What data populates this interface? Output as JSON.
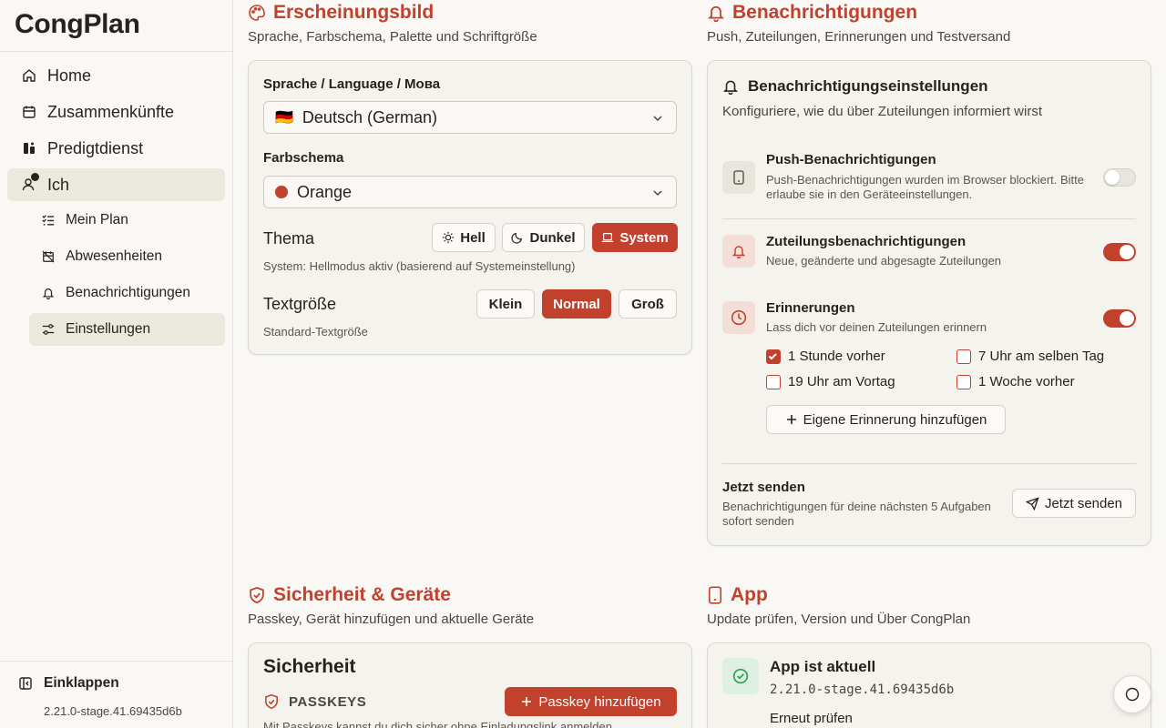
{
  "app": {
    "name": "CongPlan"
  },
  "sidebar": {
    "items": [
      {
        "label": "Home",
        "icon": "home-icon"
      },
      {
        "label": "Zusammenkünfte",
        "icon": "calendar-icon"
      },
      {
        "label": "Predigtdienst",
        "icon": "ministry-icon"
      },
      {
        "label": "Ich",
        "icon": "user-icon",
        "active": true
      }
    ],
    "sub_items": [
      {
        "label": "Mein Plan",
        "icon": "list-check-icon"
      },
      {
        "label": "Abwesenheiten",
        "icon": "calendar-off-icon"
      },
      {
        "label": "Benachrichtigungen",
        "icon": "bell-icon"
      },
      {
        "label": "Einstellungen",
        "icon": "settings-sliders-icon",
        "active": true
      }
    ],
    "collapse_label": "Einklappen",
    "version": "2.21.0-stage.41.69435d6b"
  },
  "appearance": {
    "title": "Erscheinungsbild",
    "subtitle": "Sprache, Farbschema, Palette und Schriftgröße",
    "language_label": "Sprache / Language / Мова",
    "language_flag": "🇩🇪",
    "language_value": "Deutsch (German)",
    "color_scheme_label": "Farbschema",
    "color_scheme_value": "Orange",
    "color_scheme_swatch": "#c2412d",
    "theme_label": "Thema",
    "theme_options": [
      "Hell",
      "Dunkel",
      "System"
    ],
    "theme_selected": "System",
    "theme_hint": "System: Hellmodus aktiv (basierend auf Systemeinstellung)",
    "text_size_label": "Textgröße",
    "text_size_options": [
      "Klein",
      "Normal",
      "Groß"
    ],
    "text_size_selected": "Normal",
    "text_size_hint": "Standard-Textgröße"
  },
  "notifications": {
    "title": "Benachrichtigungen",
    "subtitle": "Push, Zuteilungen, Erinnerungen und Testversand",
    "card_title": "Benachrichtigungseinstellungen",
    "card_subtitle": "Konfiguriere, wie du über Zuteilungen informiert wirst",
    "push_title": "Push-Benachrichtigungen",
    "push_desc": "Push-Benachrichtigungen wurden im Browser blockiert. Bitte erlaube sie in den Geräteeinstellungen.",
    "push_enabled": false,
    "assign_title": "Zuteilungsbenachrichtigungen",
    "assign_desc": "Neue, geänderte und abgesagte Zuteilungen",
    "assign_enabled": true,
    "remind_title": "Erinnerungen",
    "remind_desc": "Lass dich vor deinen Zuteilungen erinnern",
    "remind_enabled": true,
    "reminder_options": [
      {
        "label": "1 Stunde vorher",
        "checked": true
      },
      {
        "label": "7 Uhr am selben Tag",
        "checked": false
      },
      {
        "label": "19 Uhr am Vortag",
        "checked": false
      },
      {
        "label": "1 Woche vorher",
        "checked": false
      }
    ],
    "add_reminder_label": "Eigene Erinnerung hinzufügen",
    "send_title": "Jetzt senden",
    "send_desc": "Benachrichtigungen für deine nächsten 5 Aufgaben sofort senden",
    "send_button": "Jetzt senden"
  },
  "security": {
    "title": "Sicherheit & Geräte",
    "subtitle": "Passkey, Gerät hinzufügen und aktuelle Geräte",
    "card_title": "Sicherheit",
    "passkeys_label": "PASSKEYS",
    "add_passkey_label": "Passkey hinzufügen",
    "passkeys_desc": "Mit Passkeys kannst du dich sicher ohne Einladungslink anmelden"
  },
  "app_section": {
    "title": "App",
    "subtitle": "Update prüfen, Version und Über CongPlan",
    "status_title": "App ist aktuell",
    "version": "2.21.0-stage.41.69435d6b",
    "recheck_label": "Erneut prüfen"
  },
  "colors": {
    "accent": "#c2412d",
    "success": "#2f9e58"
  }
}
